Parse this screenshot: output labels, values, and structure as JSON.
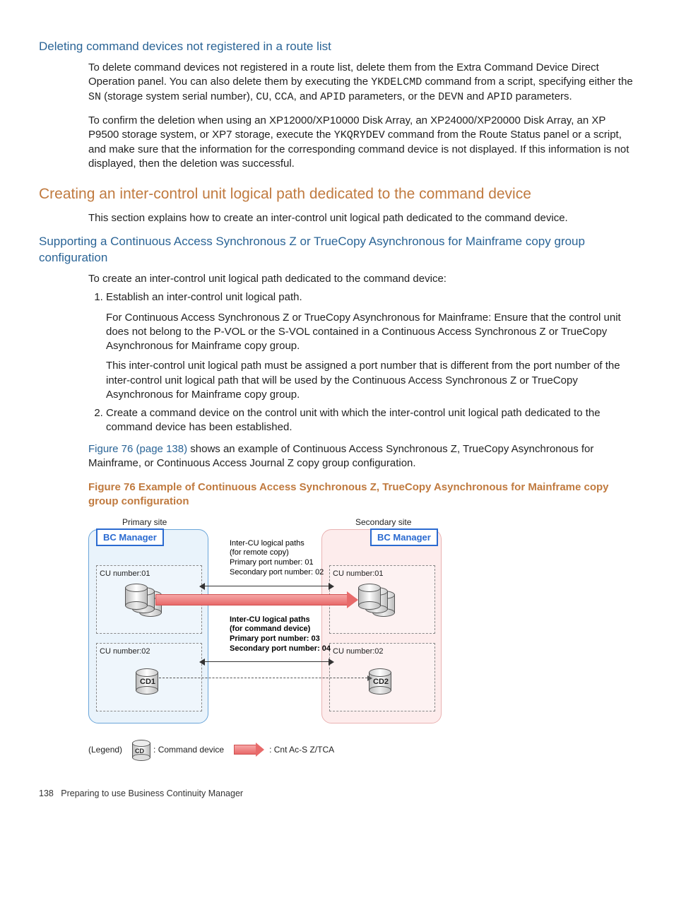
{
  "h3a": "Deleting command devices not registered in a route list",
  "p1a": "To delete command devices not registered in a route list, delete them from the Extra Command Device Direct Operation panel. You can also delete them by executing the ",
  "code1": "YKDELCMD",
  "p1b": " command from a script, specifying either the ",
  "code2": "SN",
  "p1c": " (storage system serial number), ",
  "code3": "CU",
  "p1d": ", ",
  "code4": "CCA",
  "p1e": ", and ",
  "code5": "APID",
  "p1f": " parameters, or the ",
  "code6": "DEVN",
  "p1g": " and ",
  "code7": "APID",
  "p1h": " parameters.",
  "p2a": "To confirm the deletion when using an XP12000/XP10000 Disk Array, an XP24000/XP20000 Disk Array, an XP P9500 storage system, or XP7 storage, execute the ",
  "code8": "YKQRYDEV",
  "p2b": " command from the Route Status panel or a script, and make sure that the information for the corresponding command device is not displayed. If this information is not displayed, then the deletion was successful.",
  "h2a": "Creating an inter-control unit logical path dedicated to the command device",
  "p3": "This section explains how to create an inter-control unit logical path dedicated to the command device.",
  "h3b": "Supporting a Continuous Access Synchronous Z or TrueCopy Asynchronous for Mainframe copy group configuration",
  "p4": "To create an inter-control unit logical path dedicated to the command device:",
  "li1": "Establish an inter-control unit logical path.",
  "li1p1": "For Continuous Access Synchronous Z or TrueCopy Asynchronous for Mainframe: Ensure that the control unit does not belong to the P-VOL or the S-VOL contained in a Continuous Access Synchronous Z or TrueCopy Asynchronous for Mainframe copy group.",
  "li1p2": "This inter-control unit logical path must be assigned a port number that is different from the port number of the inter-control unit logical path that will be used by the Continuous Access Synchronous Z or TrueCopy Asynchronous for Mainframe copy group.",
  "li2": "Create a command device on the control unit with which the inter-control unit logical path dedicated to the command device has been established.",
  "xref": "Figure 76 (page 138)",
  "p5b": " shows an example of Continuous Access Synchronous Z, TrueCopy Asynchronous for Mainframe, or Continuous Access Journal Z copy group configuration.",
  "figcap": "Figure 76 Example of Continuous Access Synchronous Z, TrueCopy Asynchronous for Mainframe copy group configuration",
  "fig": {
    "primary": "Primary site",
    "secondary": "Secondary site",
    "bc": "BC Manager",
    "cu01": "CU number:01",
    "cu02": "CU number:02",
    "cd1": "CD1",
    "cd2": "CD2",
    "path1l1": "Inter-CU logical paths",
    "path1l2": "(for remote copy)",
    "path1l3": "Primary port number: 01",
    "path1l4": "Secondary port number: 02",
    "path2l1": "Inter-CU logical paths",
    "path2l2": "(for command device)",
    "path2l3": "Primary port number: 03",
    "path2l4": "Secondary port number: 04",
    "legend": "(Legend)",
    "legend_cd": "CD",
    "legend_cmd": ": Command device",
    "legend_arrow": ": Cnt Ac-S Z/TCA"
  },
  "footer_num": "138",
  "footer_text": "Preparing to use Business Continuity Manager"
}
